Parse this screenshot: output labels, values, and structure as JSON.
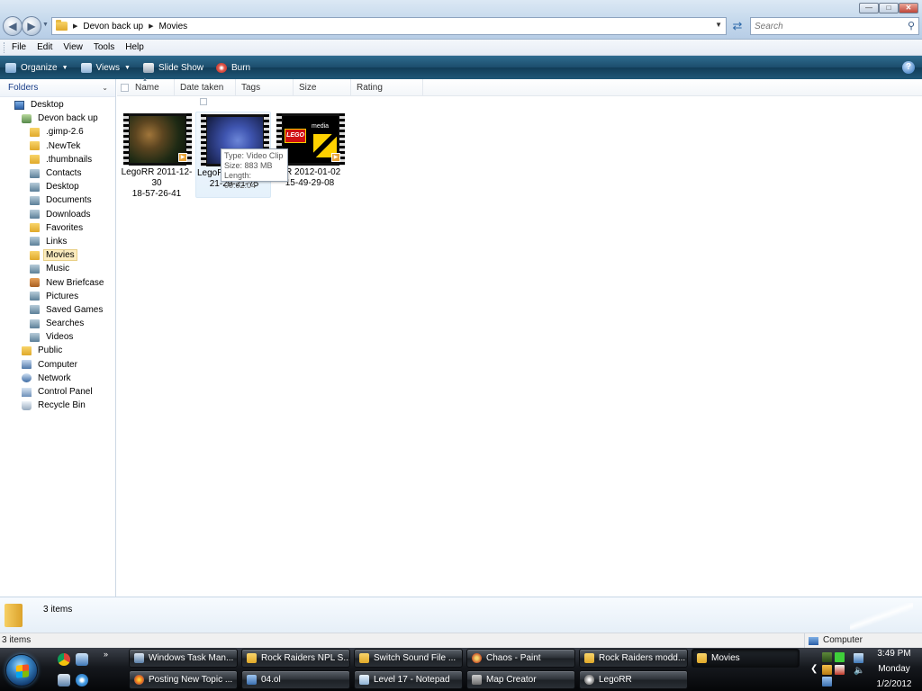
{
  "window": {
    "breadcrumbs": [
      "Devon back up",
      "Movies"
    ],
    "search_placeholder": "Search"
  },
  "menu": [
    "File",
    "Edit",
    "View",
    "Tools",
    "Help"
  ],
  "commandbar": {
    "organize": "Organize",
    "views": "Views",
    "slideshow": "Slide Show",
    "burn": "Burn"
  },
  "navpane": {
    "header": "Folders",
    "items": [
      {
        "label": "Desktop",
        "level": 0,
        "icon": "desktop-icon"
      },
      {
        "label": "Devon back up",
        "level": 1,
        "icon": "user-folder-icon"
      },
      {
        "label": ".gimp-2.6",
        "level": 2,
        "icon": "folder-icon"
      },
      {
        "label": ".NewTek",
        "level": 2,
        "icon": "folder-icon"
      },
      {
        "label": ".thumbnails",
        "level": 2,
        "icon": "folder-icon"
      },
      {
        "label": "Contacts",
        "level": 2,
        "icon": "contacts-icon"
      },
      {
        "label": "Desktop",
        "level": 2,
        "icon": "desktop-folder-icon"
      },
      {
        "label": "Documents",
        "level": 2,
        "icon": "documents-icon"
      },
      {
        "label": "Downloads",
        "level": 2,
        "icon": "downloads-icon"
      },
      {
        "label": "Favorites",
        "level": 2,
        "icon": "favorites-icon"
      },
      {
        "label": "Links",
        "level": 2,
        "icon": "links-icon"
      },
      {
        "label": "Movies",
        "level": 2,
        "icon": "folder-icon",
        "selected": true
      },
      {
        "label": "Music",
        "level": 2,
        "icon": "music-icon"
      },
      {
        "label": "New Briefcase",
        "level": 2,
        "icon": "briefcase-icon"
      },
      {
        "label": "Pictures",
        "level": 2,
        "icon": "pictures-icon"
      },
      {
        "label": "Saved Games",
        "level": 2,
        "icon": "saved-games-icon"
      },
      {
        "label": "Searches",
        "level": 2,
        "icon": "searches-icon"
      },
      {
        "label": "Videos",
        "level": 2,
        "icon": "videos-icon"
      },
      {
        "label": "Public",
        "level": 1,
        "icon": "folder-icon"
      },
      {
        "label": "Computer",
        "level": 1,
        "icon": "computer-icon"
      },
      {
        "label": "Network",
        "level": 1,
        "icon": "network-icon"
      },
      {
        "label": "Control Panel",
        "level": 1,
        "icon": "control-panel-icon"
      },
      {
        "label": "Recycle Bin",
        "level": 1,
        "icon": "recycle-bin-icon"
      }
    ]
  },
  "columns": [
    "Name",
    "Date taken",
    "Tags",
    "Size",
    "Rating"
  ],
  "files": [
    {
      "label_line1": "LegoRR 2011-12-30",
      "label_line2": "18-57-26-41"
    },
    {
      "label_line1": "LegoR",
      "label_line2": "21-29-21-75"
    },
    {
      "label_line1": "RR 2012-01-02",
      "label_line2": "15-49-29-08"
    }
  ],
  "tooltip": {
    "type": "Type: Video Clip",
    "size": "Size: 883 MB",
    "length": "Length: 00:02:04"
  },
  "thumb3": {
    "logo": "LEGO",
    "media": "media"
  },
  "details": {
    "count": "3 items"
  },
  "status": {
    "left": "3 items",
    "right": "Computer"
  },
  "taskbar": {
    "row1": [
      {
        "label": "Windows Task Man...",
        "icon": "task-manager-icon"
      },
      {
        "label": "Rock Raiders NPL S...",
        "icon": "folder-icon"
      },
      {
        "label": "Switch Sound File ...",
        "icon": "folder-icon"
      },
      {
        "label": "Chaos - Paint",
        "icon": "paint-icon"
      },
      {
        "label": "Rock Raiders modd...",
        "icon": "folder-icon"
      },
      {
        "label": "Movies",
        "icon": "folder-icon",
        "active": true
      }
    ],
    "row2": [
      {
        "label": "Posting New Topic ...",
        "icon": "firefox-icon"
      },
      {
        "label": "04.ol",
        "icon": "file-icon"
      },
      {
        "label": "Level 17 - Notepad",
        "icon": "notepad-icon"
      },
      {
        "label": "Map Creator",
        "icon": "map-creator-icon"
      },
      {
        "label": "LegoRR",
        "icon": "legorr-icon"
      }
    ]
  },
  "clock": {
    "time": "3:49 PM",
    "day": "Monday",
    "date": "1/2/2012"
  }
}
